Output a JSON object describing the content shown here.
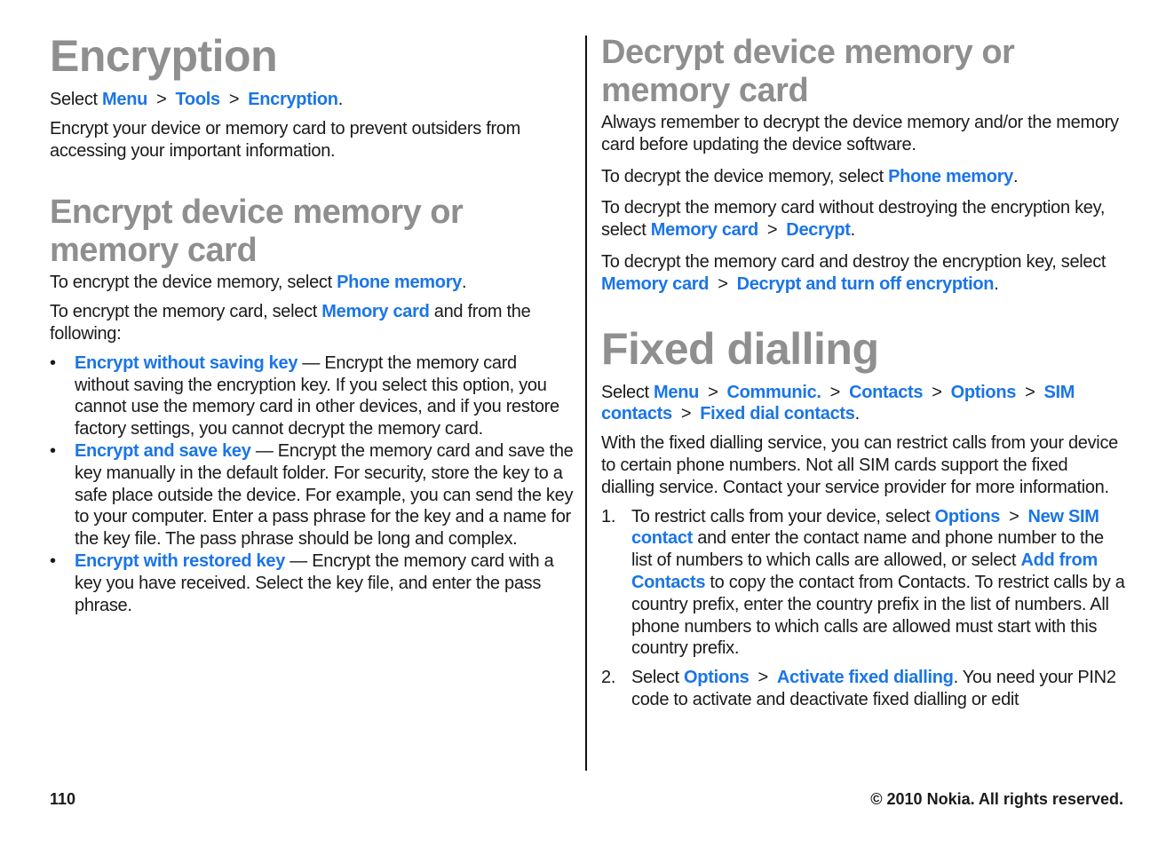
{
  "left": {
    "title": "Encryption",
    "path_prefix": "Select ",
    "path": [
      "Menu",
      "Tools",
      "Encryption"
    ],
    "intro": "Encrypt your device or memory card to prevent outsiders from accessing your important information.",
    "section_title": "Encrypt device memory or memory card",
    "p1_text": "To encrypt the device memory, select ",
    "p1_link": "Phone memory",
    "p2_text": "To encrypt the memory card, select ",
    "p2_link": "Memory card",
    "p2_tail": " and from the following:",
    "bullets": [
      {
        "link": "Encrypt without saving key",
        "text": " — Encrypt the memory card without saving the encryption key. If you select this option, you cannot use the memory card in other devices, and if you restore factory settings, you cannot decrypt the memory card."
      },
      {
        "link": "Encrypt and save key",
        "text": " — Encrypt the memory card and save the key manually in the default folder. For security, store the key to a safe place outside the device. For example, you can send the key to your computer. Enter a pass phrase for the key and a name for the key file. The pass phrase should be long and complex."
      },
      {
        "link": "Encrypt with restored key",
        "text": " — Encrypt the memory card with a key you have received. Select the key file, and enter the pass phrase."
      }
    ]
  },
  "right": {
    "section_title": "Decrypt device memory or memory card",
    "p1": "Always remember to decrypt the device memory and/or the memory card before updating the device software.",
    "p2_text": "To decrypt the device memory, select ",
    "p2_link": "Phone memory",
    "p3_text": "To decrypt the memory card without destroying the encryption key, select ",
    "p3_links": [
      "Memory card",
      "Decrypt"
    ],
    "p4_text": "To decrypt the memory card and destroy the encryption key, select ",
    "p4_links": [
      "Memory card",
      "Decrypt and turn off encryption"
    ],
    "title2": "Fixed dialling",
    "path_prefix": "Select ",
    "path": [
      "Menu",
      "Communic.",
      "Contacts",
      "Options",
      "SIM contacts",
      "Fixed dial contacts"
    ],
    "p5": "With the fixed dialling service, you can restrict calls from your device to certain phone numbers. Not all SIM cards support the fixed dialling service. Contact your service provider for more information.",
    "steps": [
      {
        "num": "1.",
        "a": "To restrict calls from your device, select ",
        "l1": "Options",
        "l2": "New SIM contact",
        "b": " and enter the contact name and phone number to the list of numbers to which calls are allowed, or select ",
        "l3": "Add from Contacts",
        "c": " to copy the contact from Contacts. To restrict calls by a country prefix, enter the country prefix in the list of numbers. All phone numbers to which calls are allowed must start with this country prefix."
      },
      {
        "num": "2.",
        "a": "Select ",
        "l1": "Options",
        "l2": "Activate fixed dialling",
        "b": ". You need your PIN2 code to activate and deactivate fixed dialling or edit"
      }
    ]
  },
  "separator": ">",
  "bullet": "•",
  "period": ".",
  "footer": {
    "page_number": "110",
    "copyright": "© 2010 Nokia. All rights reserved."
  }
}
